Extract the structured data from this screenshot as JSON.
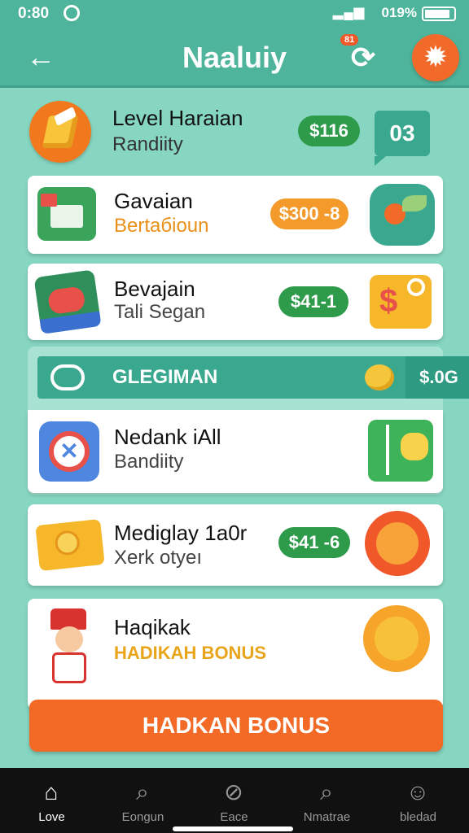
{
  "status_bar": {
    "time": "0:80",
    "battery": "019%"
  },
  "header": {
    "title": "Naaluiy",
    "refresh_badge": "81"
  },
  "level": {
    "title": "Level Haraian",
    "subtitle": "Randiity",
    "price": "$116",
    "count": "03"
  },
  "items": [
    {
      "title": "Gavaian",
      "subtitle": "Bertaбioun",
      "price": "$300 -8",
      "price_style": "orange"
    },
    {
      "title": "Bevajain",
      "subtitle": "Tali Segan",
      "price": "$41-1",
      "price_style": "green"
    }
  ],
  "section": {
    "label": "GLEGIMAN",
    "price": "$.0G",
    "item": {
      "title": "Nedank iAll",
      "subtitle": "Bandiity"
    }
  },
  "more_items": [
    {
      "title": "Mediglay 1a0r",
      "subtitle": "Xerk otyeı",
      "price": "$41 -6"
    },
    {
      "title": "Haqikak",
      "subtitle": "HADIKAH BONUS"
    }
  ],
  "cta": {
    "label": "HADKAN BONUS"
  },
  "bottom_nav": [
    {
      "label": "Love",
      "icon": "home-icon",
      "active": true
    },
    {
      "label": "Eongun",
      "icon": "search-icon",
      "active": false
    },
    {
      "label": "Eace",
      "icon": "compass-icon",
      "active": false
    },
    {
      "label": "Nmatrae",
      "icon": "search-icon",
      "active": false
    },
    {
      "label": "bledad",
      "icon": "profile-icon",
      "active": false
    }
  ],
  "colors": {
    "background": "#86d6c2",
    "header": "#4fb49c",
    "accent_orange": "#f26a25",
    "price_green": "#2e9b4b"
  }
}
